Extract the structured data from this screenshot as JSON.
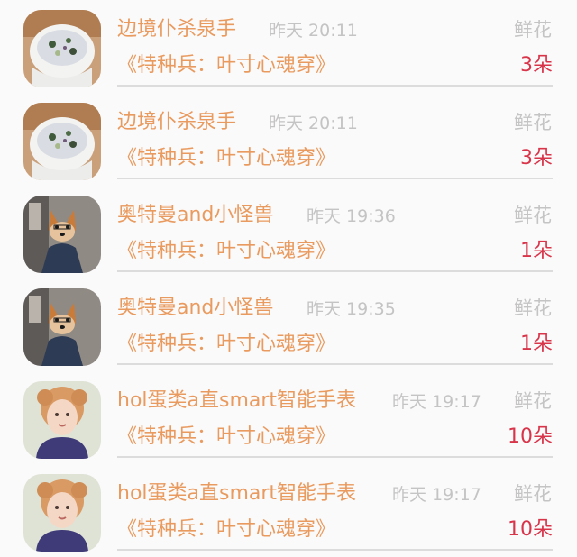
{
  "gift_list": [
    {
      "name": "边境仆杀泉手",
      "time": "昨天 20:11",
      "gift": "鲜花",
      "book": "《特种兵：叶寸心魂穿》",
      "count": "3朵",
      "avatar": "porridge-bowl"
    },
    {
      "name": "边境仆杀泉手",
      "time": "昨天 20:11",
      "gift": "鲜花",
      "book": "《特种兵：叶寸心魂穿》",
      "count": "3朵",
      "avatar": "porridge-bowl"
    },
    {
      "name": "奥特曼and小怪兽",
      "time": "昨天 19:36",
      "gift": "鲜花",
      "book": "《特种兵：叶寸心魂穿》",
      "count": "1朵",
      "avatar": "shiba-dog"
    },
    {
      "name": "奥特曼and小怪兽",
      "time": "昨天 19:35",
      "gift": "鲜花",
      "book": "《特种兵：叶寸心魂穿》",
      "count": "1朵",
      "avatar": "shiba-dog"
    },
    {
      "name": "hol蛋类a直smart智能手表",
      "time": "昨天 19:17",
      "gift": "鲜花",
      "book": "《特种兵：叶寸心魂穿》",
      "count": "10朵",
      "avatar": "girl-portrait"
    },
    {
      "name": "hol蛋类a直smart智能手表",
      "time": "昨天 19:17",
      "gift": "鲜花",
      "book": "《特种兵：叶寸心魂穿》",
      "count": "10朵",
      "avatar": "girl-portrait"
    }
  ],
  "colors": {
    "name": "#e99a5e",
    "meta": "#c4c4c4",
    "count": "#d8344a",
    "background": "#fbfafa"
  }
}
